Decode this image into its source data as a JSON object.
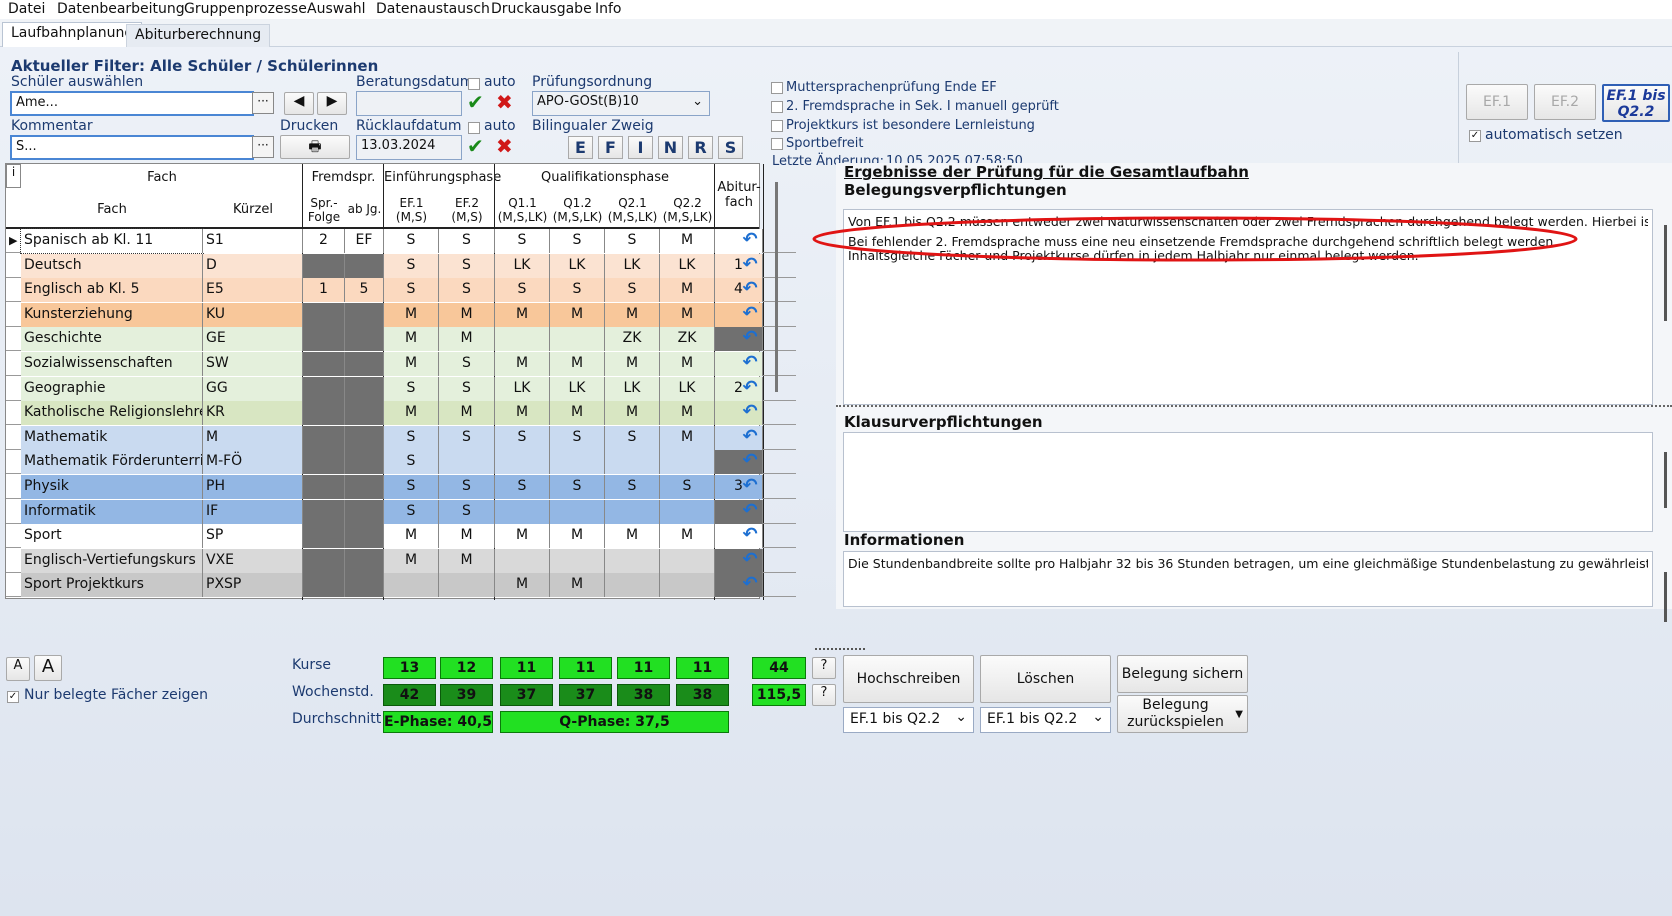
{
  "menu": [
    "Datei",
    "Datenbearbeitung",
    "Gruppenprozesse",
    "Auswahl",
    "Datenaustausch",
    "Druckausgabe",
    "Info"
  ],
  "tabs": [
    "Laufbahnplanung",
    "Abiturberechnung"
  ],
  "filter_title": "Aktueller Filter: Alle Schüler / Schülerinnen",
  "labels": {
    "schueler": "Schüler auswählen",
    "beratungsdatum": "Beratungsdatum",
    "auto": "auto",
    "pruefungsordnung": "Prüfungsordnung",
    "kommentar": "Kommentar",
    "drucken": "Drucken",
    "ruecklaufdatum": "Rücklaufdatum",
    "bilingual": "Bilingualer Zweig",
    "letzte_aenderung": "Letzte Änderung:",
    "letzte_aenderung_wert": "10.05.2025 07:58:50"
  },
  "fields": {
    "schueler_value": "Ame...",
    "kommentar_value": "S...",
    "beratungsdatum_value": "",
    "ruecklaufdatum_value": "13.03.2024",
    "pruefungsordnung_value": "APO-GOSt(B)10"
  },
  "bilingual_buttons": [
    "E",
    "F",
    "I",
    "N",
    "R",
    "S"
  ],
  "checkboxes": [
    "Muttersprachenprüfung Ende EF",
    "2. Fremdsprache in Sek. I manuell geprüft",
    "Projektkurs ist besondere Lernleistung",
    "Sportbefreit"
  ],
  "phase_buttons": [
    "EF.1",
    "EF.2",
    "EF.1 bis Q2.2"
  ],
  "auto_setzen": "automatisch setzen",
  "grid_headers": {
    "i": "i",
    "fach_group": "Fach",
    "fremdspr": "Fremdspr.",
    "einf": "Einführungsphase",
    "quali": "Qualifikationsphase",
    "abitur": "Abitur-\nfach",
    "fach": "Fach",
    "kuerzel": "Kürzel",
    "spr_folge": "Spr.-\nFolge",
    "ab_jg": "ab Jg.",
    "ef1": "EF.1\n(M,S)",
    "ef2": "EF.2\n(M,S)",
    "q11": "Q1.1\n(M,S,LK)",
    "q12": "Q1.2\n(M,S,LK)",
    "q21": "Q2.1\n(M,S,LK)",
    "q22": "Q2.2\n(M,S,LK)"
  },
  "rows": [
    {
      "fach": "Spanisch ab Kl. 11",
      "kuerzel": "S1",
      "folge": "2",
      "abjg": "EF",
      "ef1": "S",
      "ef2": "S",
      "q11": "S",
      "q12": "S",
      "q21": "S",
      "q22": "M",
      "abi": "",
      "color": "#ffffff",
      "dark_fs": false,
      "dark_abi": false
    },
    {
      "fach": "Deutsch",
      "kuerzel": "D",
      "folge": "",
      "abjg": "",
      "ef1": "S",
      "ef2": "S",
      "q11": "LK",
      "q12": "LK",
      "q21": "LK",
      "q22": "LK",
      "abi": "1",
      "color": "#fbe3d2",
      "dark_fs": true,
      "dark_abi": false
    },
    {
      "fach": "Englisch ab Kl. 5",
      "kuerzel": "E5",
      "folge": "1",
      "abjg": "5",
      "ef1": "S",
      "ef2": "S",
      "q11": "S",
      "q12": "S",
      "q21": "S",
      "q22": "M",
      "abi": "4",
      "color": "#fbd9bf",
      "dark_fs": false,
      "dark_abi": false
    },
    {
      "fach": "Kunsterziehung",
      "kuerzel": "KU",
      "folge": "",
      "abjg": "",
      "ef1": "M",
      "ef2": "M",
      "q11": "M",
      "q12": "M",
      "q21": "M",
      "q22": "M",
      "abi": "",
      "color": "#f8c79a",
      "dark_fs": true,
      "dark_abi": false
    },
    {
      "fach": "Geschichte",
      "kuerzel": "GE",
      "folge": "",
      "abjg": "",
      "ef1": "M",
      "ef2": "M",
      "q11": "",
      "q12": "",
      "q21": "ZK",
      "q22": "ZK",
      "abi": "",
      "color": "#e4f0dc",
      "dark_fs": true,
      "dark_abi": true
    },
    {
      "fach": "Sozialwissenschaften",
      "kuerzel": "SW",
      "folge": "",
      "abjg": "",
      "ef1": "M",
      "ef2": "S",
      "q11": "M",
      "q12": "M",
      "q21": "M",
      "q22": "M",
      "abi": "",
      "color": "#e4f0dc",
      "dark_fs": true,
      "dark_abi": false
    },
    {
      "fach": "Geographie",
      "kuerzel": "GG",
      "folge": "",
      "abjg": "",
      "ef1": "S",
      "ef2": "S",
      "q11": "LK",
      "q12": "LK",
      "q21": "LK",
      "q22": "LK",
      "abi": "2",
      "color": "#e4f0dc",
      "dark_fs": true,
      "dark_abi": false
    },
    {
      "fach": "Katholische Religionslehre",
      "kuerzel": "KR",
      "folge": "",
      "abjg": "",
      "ef1": "M",
      "ef2": "M",
      "q11": "M",
      "q12": "M",
      "q21": "M",
      "q22": "M",
      "abi": "",
      "color": "#d8e6c2",
      "dark_fs": true,
      "dark_abi": false
    },
    {
      "fach": "Mathematik",
      "kuerzel": "M",
      "folge": "",
      "abjg": "",
      "ef1": "S",
      "ef2": "S",
      "q11": "S",
      "q12": "S",
      "q21": "S",
      "q22": "M",
      "abi": "",
      "color": "#c9daf0",
      "dark_fs": true,
      "dark_abi": false
    },
    {
      "fach": "Mathematik Förderunterricht",
      "kuerzel": "M-FÖ",
      "folge": "",
      "abjg": "",
      "ef1": "S",
      "ef2": "",
      "q11": "",
      "q12": "",
      "q21": "",
      "q22": "",
      "abi": "",
      "color": "#c9daf0",
      "dark_fs": true,
      "dark_abi": true
    },
    {
      "fach": "Physik",
      "kuerzel": "PH",
      "folge": "",
      "abjg": "",
      "ef1": "S",
      "ef2": "S",
      "q11": "S",
      "q12": "S",
      "q21": "S",
      "q22": "S",
      "abi": "3",
      "color": "#93b7e4",
      "dark_fs": true,
      "dark_abi": false
    },
    {
      "fach": "Informatik",
      "kuerzel": "IF",
      "folge": "",
      "abjg": "",
      "ef1": "S",
      "ef2": "S",
      "q11": "",
      "q12": "",
      "q21": "",
      "q22": "",
      "abi": "",
      "color": "#93b7e4",
      "dark_fs": true,
      "dark_abi": true
    },
    {
      "fach": "Sport",
      "kuerzel": "SP",
      "folge": "",
      "abjg": "",
      "ef1": "M",
      "ef2": "M",
      "q11": "M",
      "q12": "M",
      "q21": "M",
      "q22": "M",
      "abi": "",
      "color": "#ffffff",
      "dark_fs": true,
      "dark_abi": false
    },
    {
      "fach": "Englisch-Vertiefungskurs",
      "kuerzel": "VXE",
      "folge": "",
      "abjg": "",
      "ef1": "M",
      "ef2": "M",
      "q11": "",
      "q12": "",
      "q21": "",
      "q22": "",
      "abi": "",
      "color": "#d9d9d9",
      "dark_fs": true,
      "dark_abi": true
    },
    {
      "fach": "Sport Projektkurs",
      "kuerzel": "PXSP",
      "folge": "",
      "abjg": "",
      "ef1": "",
      "ef2": "",
      "q11": "M",
      "q12": "M",
      "q21": "",
      "q22": "",
      "abi": "",
      "color": "#c8c8c8",
      "dark_fs": true,
      "dark_abi": true
    }
  ],
  "results": {
    "title": "Ergebnisse der Prüfung für die Gesamtlaufbahn",
    "belegung_title": "Belegungsverpflichtungen",
    "belegung_lines": [
      "Von EF.1 bis Q2.2 müssen entweder zwei Naturwissenschaften oder zwei Fremdsprachen durchgehend belegt werden. Hierbei ist eine",
      "Bei fehlender 2. Fremdsprache muss eine neu einsetzende Fremdsprache durchgehend schriftlich belegt werden.",
      "Inhaltsgleiche Fächer und Projektkurse dürfen in jedem Halbjahr nur einmal belegt werden."
    ],
    "klausur_title": "Klausurverpflichtungen",
    "info_title": "Informationen",
    "info_lines": [
      "Die Stundenbandbreite sollte pro Halbjahr 32 bis 36 Stunden betragen, um eine gleichmäßige Stundenbelastung zu gewährleisten"
    ]
  },
  "bottom": {
    "font_small": "A",
    "font_big": "A",
    "nur_belegte": "Nur belegte Fächer zeigen",
    "kurse_label": "Kurse",
    "wochenstd_label": "Wochenstd.",
    "durchschnitt_label": "Durchschnitt",
    "kurse": [
      "13",
      "12",
      "11",
      "11",
      "11",
      "11"
    ],
    "kurse_total": "44",
    "wochenstd": [
      "42",
      "39",
      "37",
      "37",
      "38",
      "38"
    ],
    "wochenstd_total": "115,5",
    "e_phase": "E-Phase: 40,5",
    "q_phase": "Q-Phase: 37,5",
    "help": "?",
    "hochschreiben": "Hochschreiben",
    "loeschen": "Löschen",
    "belegung_sichern": "Belegung sichern",
    "belegung_zurueck": "Belegung zurückspielen",
    "combo1": "EF.1 bis Q2.2",
    "combo2": "EF.1 bis Q2.2"
  }
}
